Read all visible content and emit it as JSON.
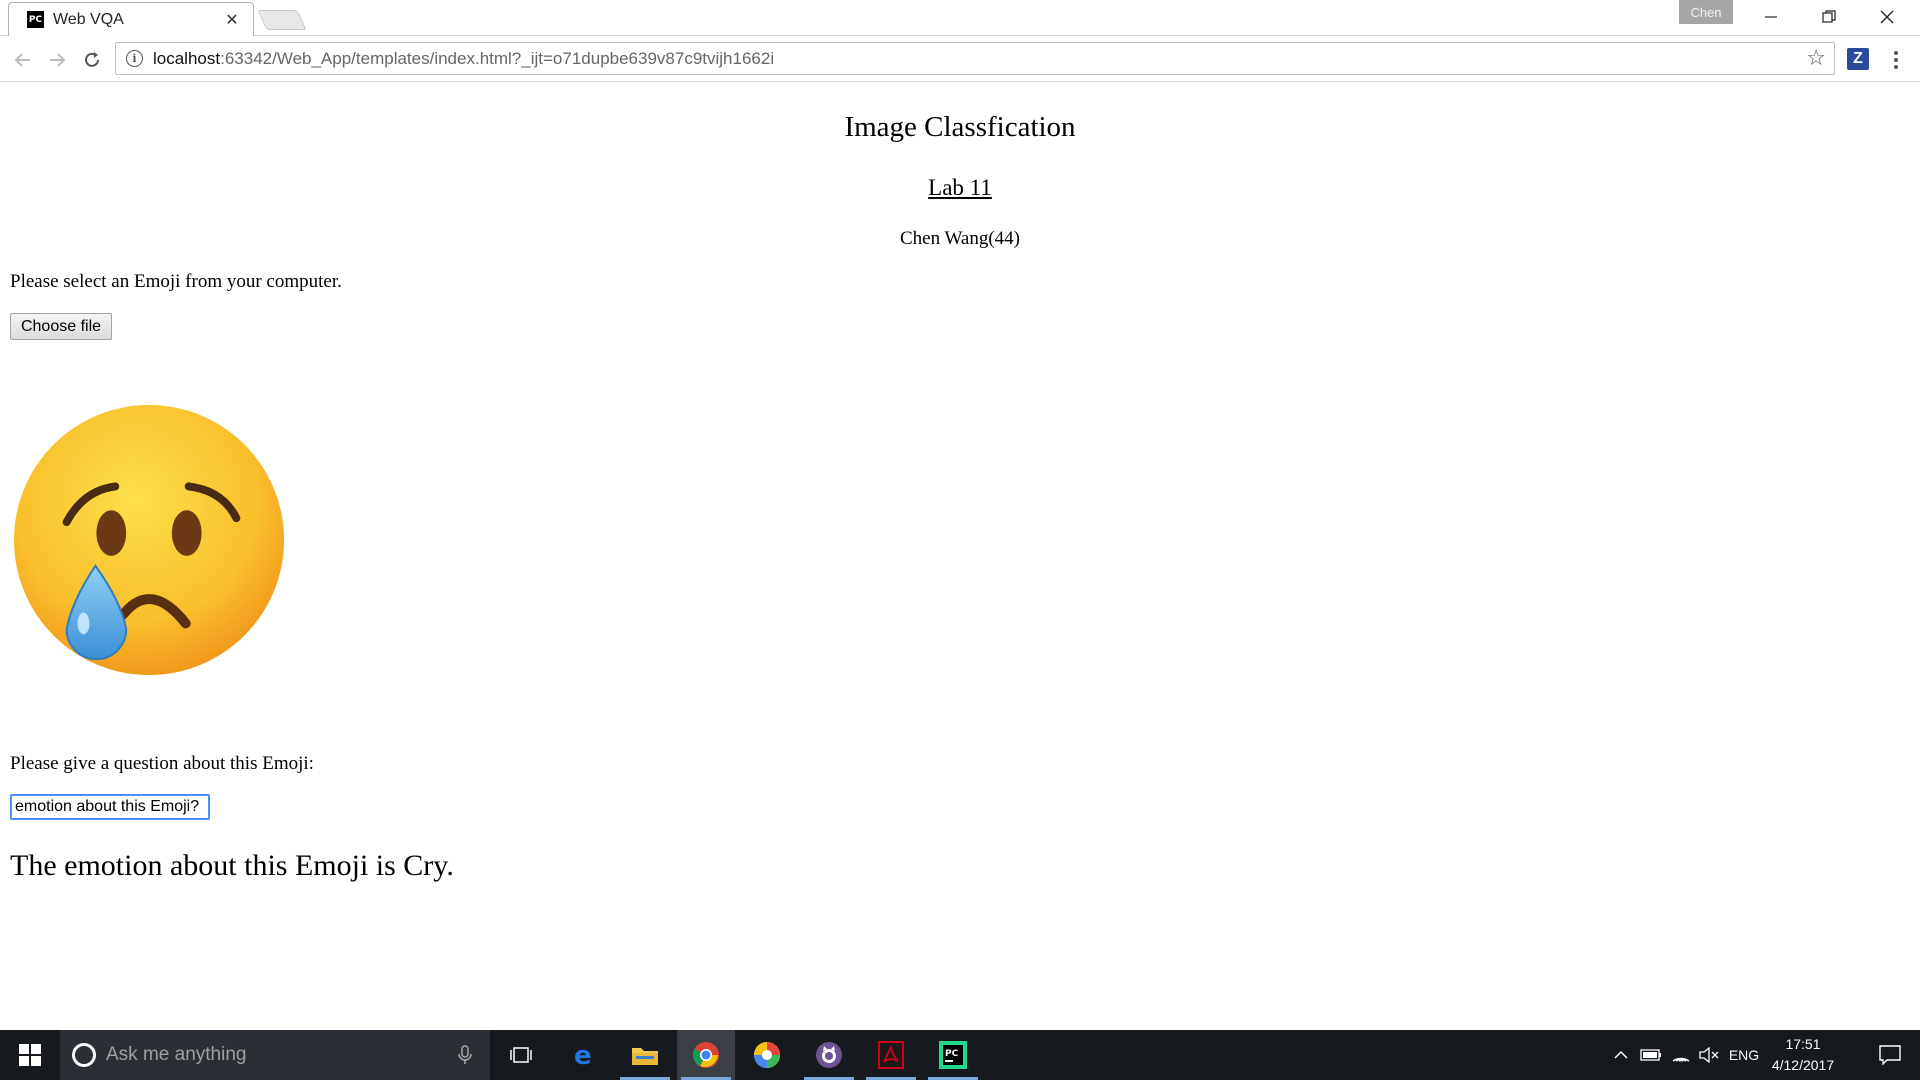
{
  "browser": {
    "tab_title": "Web VQA",
    "tab_icon": "pycharm-icon",
    "profile_name": "Chen",
    "url_host": "localhost",
    "url_rest": ":63342/Web_App/templates/index.html?_ijt=o71dupbe639v87c9tvijh1662i",
    "extension_label": "Z"
  },
  "page": {
    "title": "Image Classfication",
    "lab_link": "Lab 11",
    "author": "Chen Wang(44)",
    "select_prompt": "Please select an Emoji from your computer.",
    "file_button_label": "Choose file",
    "emoji_image": "crying-face-emoji",
    "question_prompt": "Please give a question about this Emoji:",
    "question_value": "emotion about this Emoji?",
    "answer": "The emotion about this Emoji is Cry."
  },
  "taskbar": {
    "search_placeholder": "Ask me anything",
    "apps": [
      "task-view-icon",
      "edge-icon",
      "file-explorer-icon",
      "chrome-icon",
      "picasa-icon",
      "github-icon",
      "acrobat-icon",
      "pycharm-icon"
    ],
    "language": "ENG",
    "time": "17:51",
    "date": "4/12/2017"
  },
  "colors": {
    "accent_focus": "#4d90fe",
    "taskbar_bg": "#16191d",
    "emoji_face": "#f8b62f",
    "tear": "#5aa9e6"
  }
}
